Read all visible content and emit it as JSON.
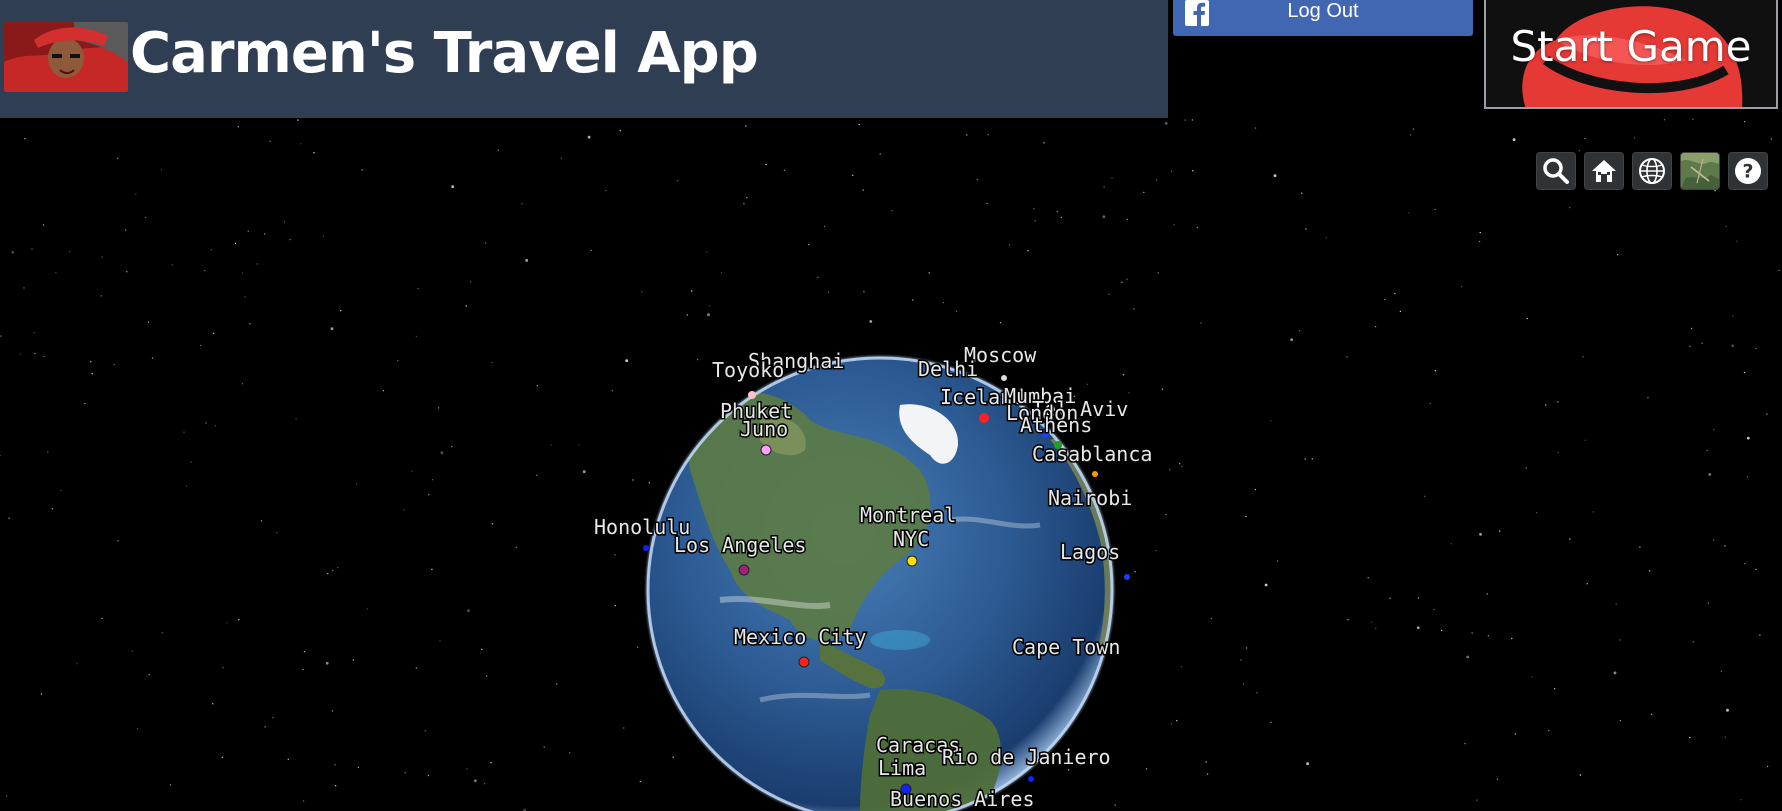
{
  "header": {
    "title": "Carmen's Travel App",
    "background_color": "#2f3e52"
  },
  "auth": {
    "logout_label": "Log Out",
    "button_color": "#4267b2"
  },
  "game": {
    "start_label": "Start Game",
    "hat_color": "#e02b2b"
  },
  "toolbar": {
    "buttons": [
      {
        "name": "search-icon",
        "label": "Search"
      },
      {
        "name": "home-icon",
        "label": "Home"
      },
      {
        "name": "globe-icon",
        "label": "Scene mode"
      },
      {
        "name": "imagery-icon",
        "label": "Base layer"
      },
      {
        "name": "help-icon",
        "label": "Help"
      }
    ]
  },
  "map": {
    "view": "3D globe",
    "cities": [
      {
        "name": "Shanghai",
        "dot_color": ""
      },
      {
        "name": "Toyoko",
        "dot_color": "#ffc0cb"
      },
      {
        "name": "Moscow",
        "dot_color": "#dddddd"
      },
      {
        "name": "Delhi",
        "dot_color": ""
      },
      {
        "name": "Iceland",
        "dot_color": "#ff2020"
      },
      {
        "name": "Mumbai",
        "dot_color": ""
      },
      {
        "name": "Tel Aviv",
        "dot_color": ""
      },
      {
        "name": "London",
        "dot_color": "#2040ff"
      },
      {
        "name": "Athens",
        "dot_color": "#20a020"
      },
      {
        "name": "Casablanca",
        "dot_color": "#ff9900"
      },
      {
        "name": "Nairobi",
        "dot_color": ""
      },
      {
        "name": "Lagos",
        "dot_color": "#1040ff"
      },
      {
        "name": "Cape Town",
        "dot_color": ""
      },
      {
        "name": "Phuket",
        "dot_color": ""
      },
      {
        "name": "Juno",
        "dot_color": "#ffa0ff"
      },
      {
        "name": "Honolulu",
        "dot_color": "#1020ff"
      },
      {
        "name": "Los Angeles",
        "dot_color": "#a0207a"
      },
      {
        "name": "Montreal",
        "dot_color": ""
      },
      {
        "name": "NYC",
        "dot_color": "#ffe000"
      },
      {
        "name": "Mexico City",
        "dot_color": "#ff2020"
      },
      {
        "name": "Caracas",
        "dot_color": ""
      },
      {
        "name": "Lima",
        "dot_color": "#1020ff"
      },
      {
        "name": "Rio de Janiero",
        "dot_color": "#1020ff"
      },
      {
        "name": "Buenos Aires",
        "dot_color": ""
      }
    ]
  }
}
